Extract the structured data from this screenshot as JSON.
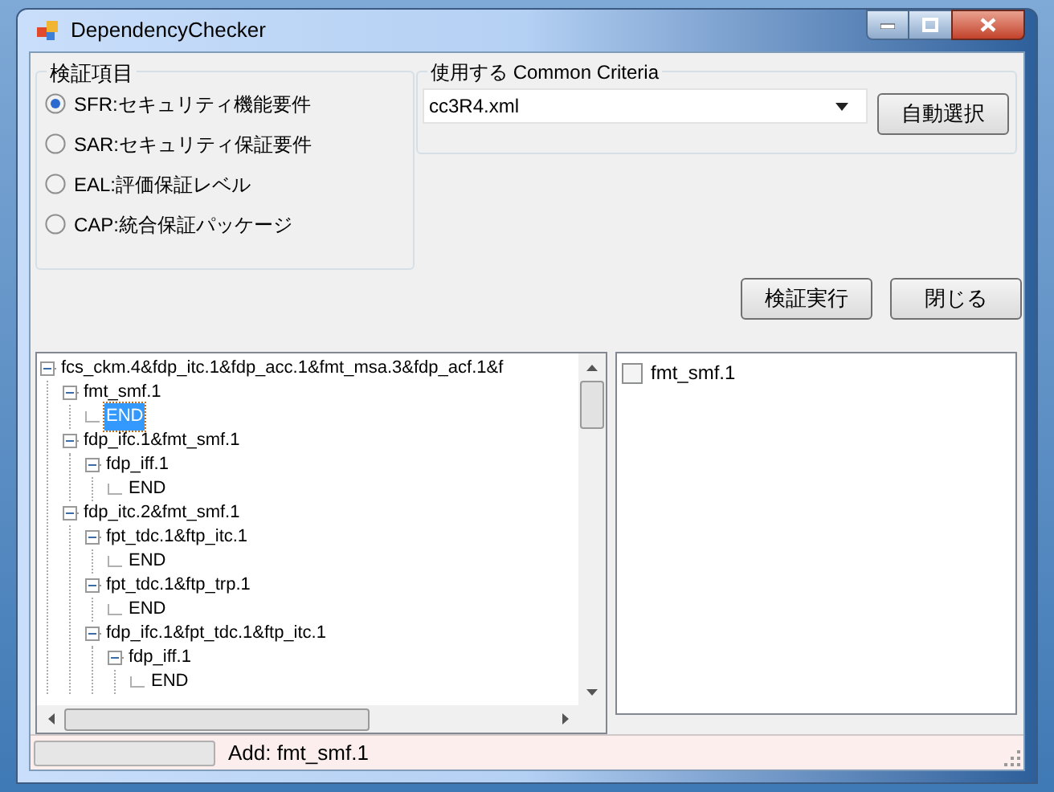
{
  "window": {
    "title": "DependencyChecker"
  },
  "check_items": {
    "title": "検証項目",
    "options": [
      {
        "label": "SFR:セキュリティ機能要件",
        "selected": true
      },
      {
        "label": "SAR:セキュリティ保証要件",
        "selected": false
      },
      {
        "label": "EAL:評価保証レベル",
        "selected": false
      },
      {
        "label": "CAP:統合保証パッケージ",
        "selected": false
      }
    ]
  },
  "criteria": {
    "title": "使用する Common Criteria",
    "value": "cc3R4.xml",
    "auto_button": "自動選択"
  },
  "buttons": [
    "検証実行",
    "閉じる"
  ],
  "tree": [
    {
      "label": "fcs_ckm.4&fdp_itc.1&fdp_acc.1&fmt_msa.3&fdp_acf.1&f",
      "expanded": true,
      "selected": false,
      "children": [
        {
          "label": "fmt_smf.1",
          "expanded": true,
          "selected": false,
          "children": [
            {
              "label": "END",
              "selected": true
            }
          ]
        },
        {
          "label": "fdp_ifc.1&fmt_smf.1",
          "expanded": true,
          "selected": false,
          "children": [
            {
              "label": "fdp_iff.1",
              "expanded": true,
              "selected": false,
              "children": [
                {
                  "label": "END",
                  "selected": false
                }
              ]
            }
          ]
        },
        {
          "label": "fdp_itc.2&fmt_smf.1",
          "expanded": true,
          "selected": false,
          "children": [
            {
              "label": "fpt_tdc.1&ftp_itc.1",
              "expanded": true,
              "selected": false,
              "children": [
                {
                  "label": "END",
                  "selected": false
                }
              ]
            },
            {
              "label": "fpt_tdc.1&ftp_trp.1",
              "expanded": true,
              "selected": false,
              "children": [
                {
                  "label": "END",
                  "selected": false
                }
              ]
            },
            {
              "label": "fdp_ifc.1&fpt_tdc.1&ftp_itc.1",
              "expanded": true,
              "selected": false,
              "children": [
                {
                  "label": "fdp_iff.1",
                  "expanded": true,
                  "selected": false,
                  "children": [
                    {
                      "label": "END",
                      "selected": false
                    }
                  ]
                }
              ]
            }
          ]
        }
      ]
    }
  ],
  "check_list": [
    {
      "label": "fmt_smf.1",
      "checked": false
    }
  ],
  "status_bar": {
    "progress": {
      "level": 0
    },
    "text": "Add: fmt_smf.1"
  }
}
